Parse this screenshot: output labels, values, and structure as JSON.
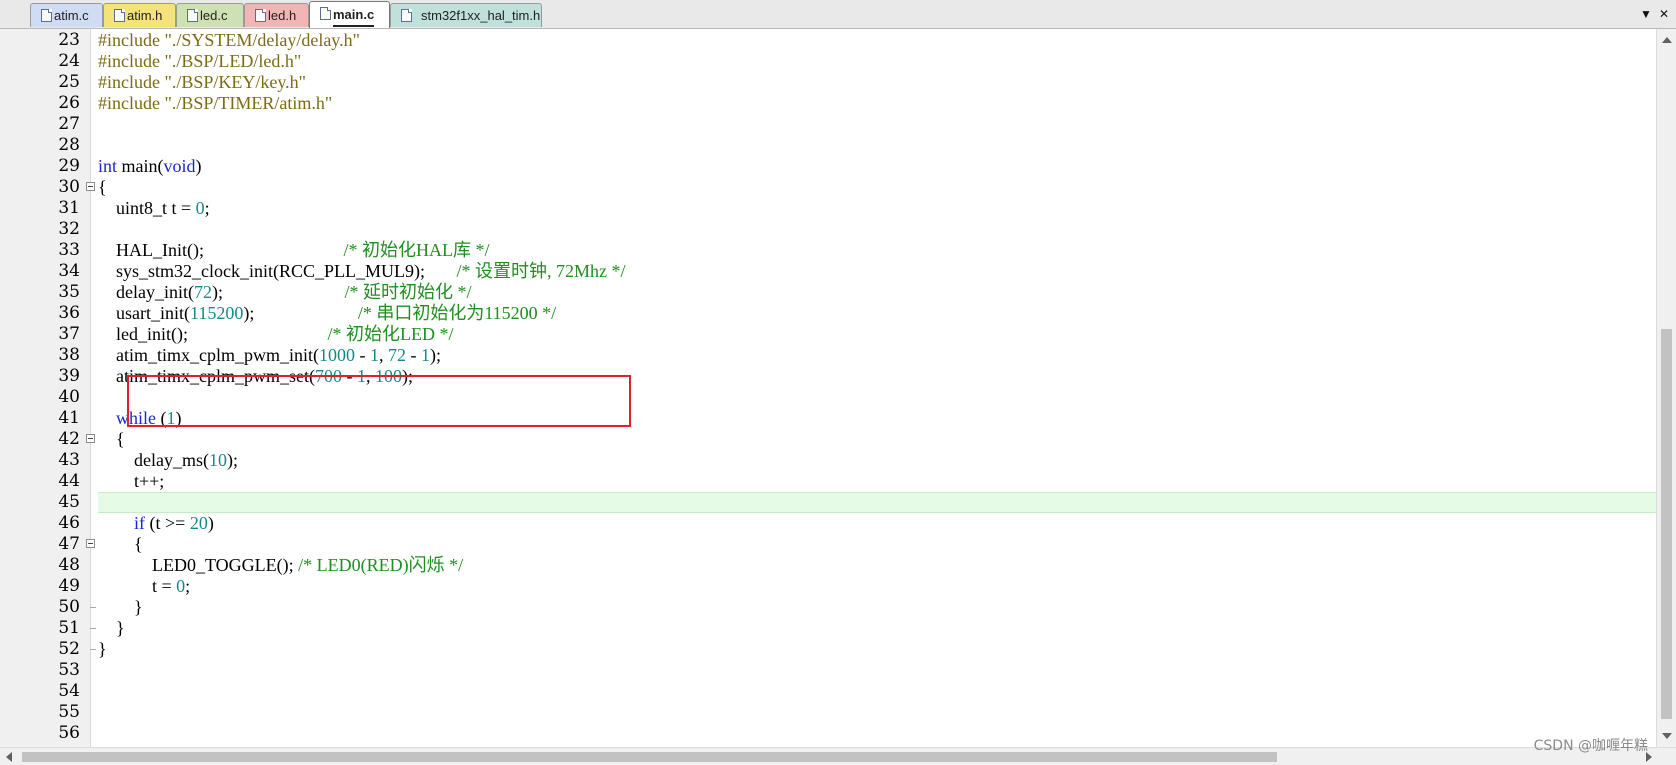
{
  "tabs": [
    {
      "label": "atim.c",
      "color": "#cfdcf2"
    },
    {
      "label": "atim.h",
      "color": "#f4e27a"
    },
    {
      "label": "led.c",
      "color": "#cde1b3"
    },
    {
      "label": "led.h",
      "color": "#f2b5b5"
    },
    {
      "label": "main.c",
      "color": "#ffffff",
      "active": true
    },
    {
      "label": "stm32f1xx_hal_tim.h",
      "color": "#bfe0db"
    }
  ],
  "tab_overflow_icon": "chevron-down-icon",
  "tab_close_icon": "close-icon",
  "editor": {
    "current_line": 45,
    "highlight_box_lines": [
      38,
      39
    ],
    "highlight_color": "#e0202a",
    "lines": [
      {
        "n": "23",
        "tokens": [
          {
            "c": "pp",
            "t": "#include \"./SYSTEM/delay/delay.h\""
          }
        ]
      },
      {
        "n": "24",
        "tokens": [
          {
            "c": "pp",
            "t": "#include \"./BSP/LED/led.h\""
          }
        ]
      },
      {
        "n": "25",
        "tokens": [
          {
            "c": "pp",
            "t": "#include \"./BSP/KEY/key.h\""
          }
        ]
      },
      {
        "n": "26",
        "tokens": [
          {
            "c": "pp",
            "t": "#include \"./BSP/TIMER/atim.h\""
          }
        ]
      },
      {
        "n": "27",
        "tokens": []
      },
      {
        "n": "28",
        "tokens": []
      },
      {
        "n": "29",
        "tokens": [
          {
            "c": "kw",
            "t": "int"
          },
          {
            "t": " main("
          },
          {
            "c": "kw",
            "t": "void"
          },
          {
            "t": ")"
          }
        ]
      },
      {
        "n": "30",
        "fold": "open",
        "tokens": [
          {
            "t": "{"
          }
        ]
      },
      {
        "n": "31",
        "tokens": [
          {
            "t": "    uint8_t t = "
          },
          {
            "c": "num",
            "t": "0"
          },
          {
            "t": ";"
          }
        ]
      },
      {
        "n": "32",
        "tokens": []
      },
      {
        "n": "33",
        "tokens": [
          {
            "t": "    HAL_Init();                               "
          },
          {
            "c": "cmt",
            "t": "/* 初始化HAL库 */"
          }
        ]
      },
      {
        "n": "34",
        "tokens": [
          {
            "t": "    sys_stm32_clock_init(RCC_PLL_MUL9);       "
          },
          {
            "c": "cmt",
            "t": "/* 设置时钟, 72Mhz */"
          }
        ]
      },
      {
        "n": "35",
        "tokens": [
          {
            "t": "    delay_init("
          },
          {
            "c": "num",
            "t": "72"
          },
          {
            "t": ");                           "
          },
          {
            "c": "cmt",
            "t": "/* 延时初始化 */"
          }
        ]
      },
      {
        "n": "36",
        "tokens": [
          {
            "t": "    usart_init("
          },
          {
            "c": "num",
            "t": "115200"
          },
          {
            "t": ");                       "
          },
          {
            "c": "cmt",
            "t": "/* 串口初始化为115200 */"
          }
        ]
      },
      {
        "n": "37",
        "tokens": [
          {
            "t": "    led_init();                               "
          },
          {
            "c": "cmt",
            "t": "/* 初始化LED */"
          }
        ]
      },
      {
        "n": "38",
        "tokens": [
          {
            "t": "    atim_timx_cplm_pwm_init("
          },
          {
            "c": "num",
            "t": "1000"
          },
          {
            "t": " - "
          },
          {
            "c": "num",
            "t": "1"
          },
          {
            "t": ", "
          },
          {
            "c": "num",
            "t": "72"
          },
          {
            "t": " - "
          },
          {
            "c": "num",
            "t": "1"
          },
          {
            "t": ");"
          }
        ]
      },
      {
        "n": "39",
        "tokens": [
          {
            "t": "    atim_timx_cplm_pwm_set("
          },
          {
            "c": "num",
            "t": "700"
          },
          {
            "t": " - "
          },
          {
            "c": "num",
            "t": "1"
          },
          {
            "t": ", "
          },
          {
            "c": "num",
            "t": "100"
          },
          {
            "t": ");"
          }
        ]
      },
      {
        "n": "40",
        "tokens": []
      },
      {
        "n": "41",
        "tokens": [
          {
            "t": "    "
          },
          {
            "c": "kw",
            "t": "while"
          },
          {
            "t": " ("
          },
          {
            "c": "num",
            "t": "1"
          },
          {
            "t": ")"
          }
        ]
      },
      {
        "n": "42",
        "fold": "open",
        "tokens": [
          {
            "t": "    {"
          }
        ]
      },
      {
        "n": "43",
        "tokens": [
          {
            "t": "        delay_ms("
          },
          {
            "c": "num",
            "t": "10"
          },
          {
            "t": ");"
          }
        ]
      },
      {
        "n": "44",
        "tokens": [
          {
            "t": "        t++;"
          }
        ]
      },
      {
        "n": "45",
        "tokens": []
      },
      {
        "n": "46",
        "tokens": [
          {
            "t": "        "
          },
          {
            "c": "kw",
            "t": "if"
          },
          {
            "t": " (t >= "
          },
          {
            "c": "num",
            "t": "20"
          },
          {
            "t": ")"
          }
        ]
      },
      {
        "n": "47",
        "fold": "open",
        "tokens": [
          {
            "t": "        {"
          }
        ]
      },
      {
        "n": "48",
        "tokens": [
          {
            "t": "            LED0_TOGGLE(); "
          },
          {
            "c": "cmt",
            "t": "/* LED0(RED)闪烁 */"
          }
        ]
      },
      {
        "n": "49",
        "tokens": [
          {
            "t": "            t = "
          },
          {
            "c": "num",
            "t": "0"
          },
          {
            "t": ";"
          }
        ]
      },
      {
        "n": "50",
        "fold": "end",
        "tokens": [
          {
            "t": "        }"
          }
        ]
      },
      {
        "n": "51",
        "fold": "end",
        "tokens": [
          {
            "t": "    }"
          }
        ]
      },
      {
        "n": "52",
        "fold": "end",
        "tokens": [
          {
            "t": "}"
          }
        ]
      },
      {
        "n": "53",
        "tokens": []
      },
      {
        "n": "54",
        "tokens": []
      },
      {
        "n": "55",
        "tokens": []
      },
      {
        "n": "56",
        "tokens": []
      }
    ]
  },
  "watermark": "CSDN @咖喱年糕"
}
